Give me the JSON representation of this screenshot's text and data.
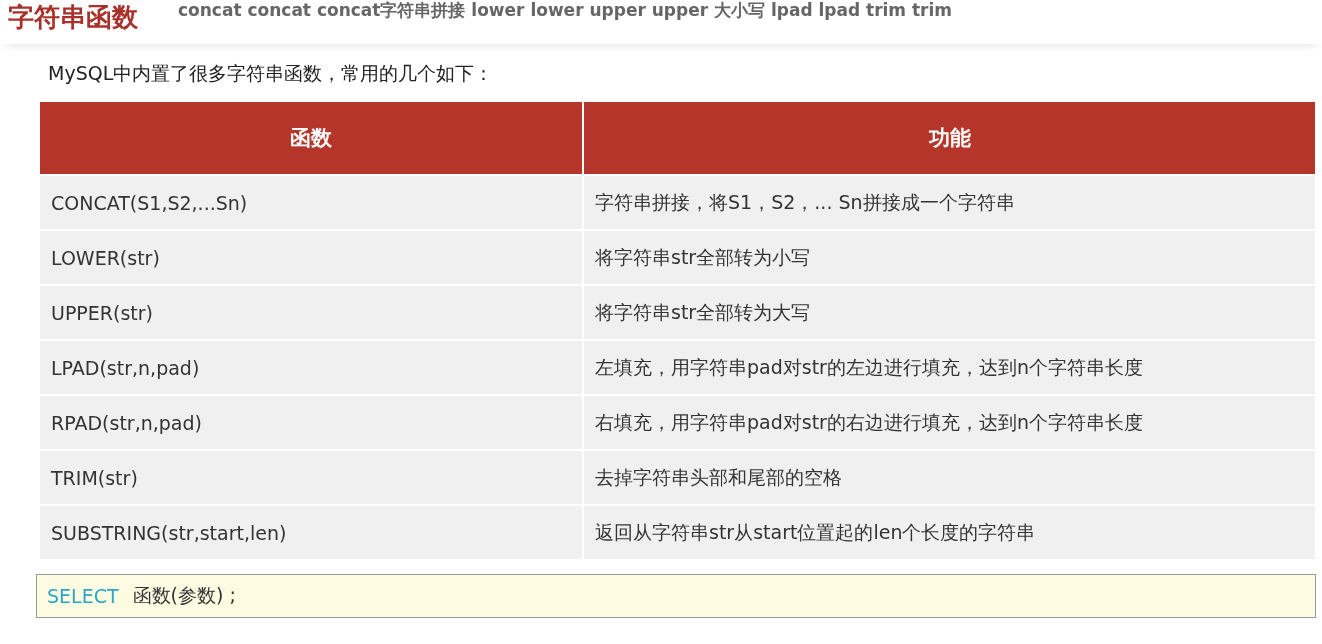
{
  "title": "字符串函数",
  "caption_overlay": "concat concat concat字符串拼接   lower lower upper upper 大小写   lpad lpad trim trim",
  "intro": "MySQL中内置了很多字符串函数，常用的几个如下：",
  "table": {
    "columns": [
      "函数",
      "功能"
    ],
    "rows": [
      [
        "CONCAT(S1,S2,...Sn)",
        "字符串拼接，将S1，S2，... Sn拼接成一个字符串"
      ],
      [
        "LOWER(str)",
        "将字符串str全部转为小写"
      ],
      [
        "UPPER(str)",
        "将字符串str全部转为大写"
      ],
      [
        "LPAD(str,n,pad)",
        "左填充，用字符串pad对str的左边进行填充，达到n个字符串长度"
      ],
      [
        "RPAD(str,n,pad)",
        "右填充，用字符串pad对str的右边进行填充，达到n个字符串长度"
      ],
      [
        "TRIM(str)",
        "去掉字符串头部和尾部的空格"
      ],
      [
        "SUBSTRING(str,start,len)",
        "返回从字符串str从start位置起的len个长度的字符串"
      ]
    ]
  },
  "code": {
    "keyword": "SELECT",
    "text": "函数(参数) ;"
  }
}
